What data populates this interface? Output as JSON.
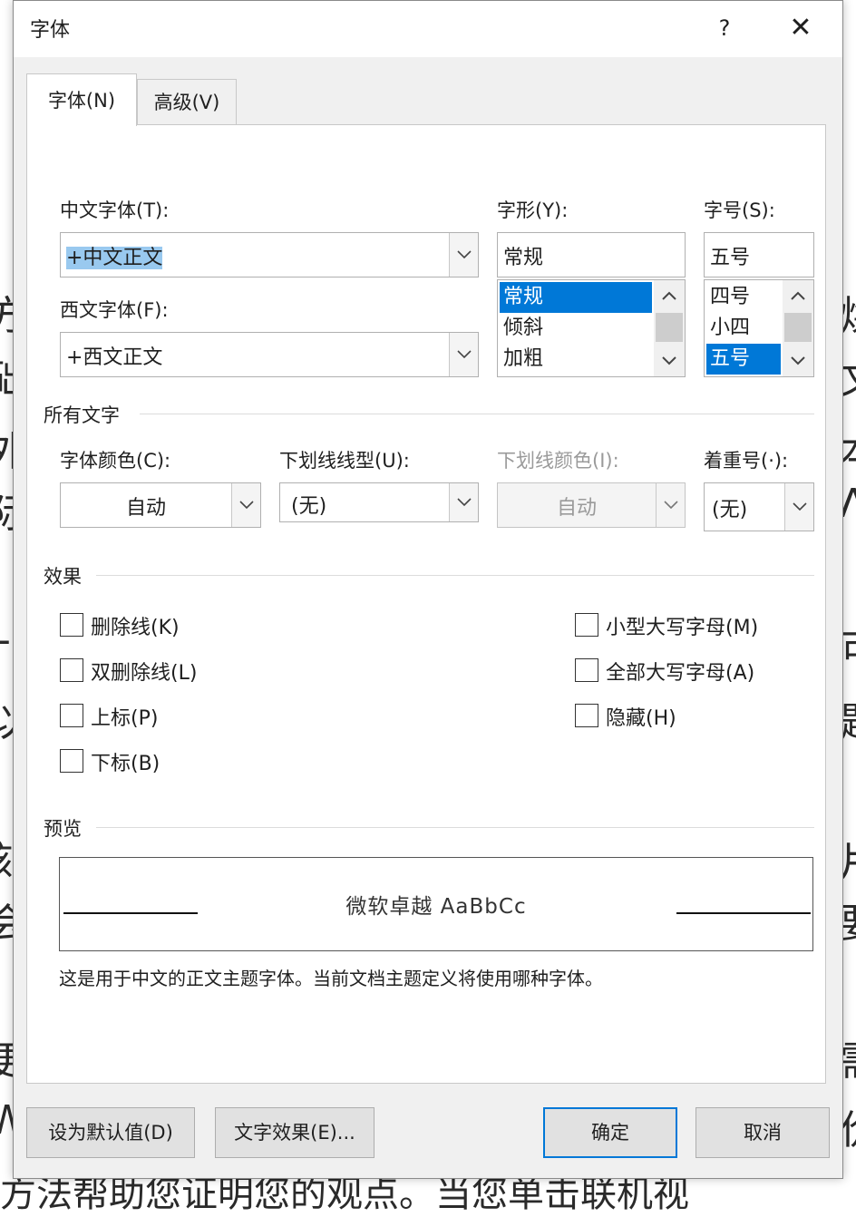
{
  "dialog": {
    "title": "字体",
    "help": "?",
    "close": "✕"
  },
  "tabs": [
    {
      "label": "字体(N)",
      "active": true
    },
    {
      "label": "高级(V)",
      "active": false
    }
  ],
  "fonts": {
    "chinese_label": "中文字体(T):",
    "chinese_value": "+中文正文",
    "western_label": "西文字体(F):",
    "western_value": "+西文正文"
  },
  "style": {
    "label": "字形(Y):",
    "value": "常规",
    "options": [
      "常规",
      "倾斜",
      "加粗"
    ],
    "selected": "常规"
  },
  "size": {
    "label": "字号(S):",
    "value": "五号",
    "options": [
      "四号",
      "小四",
      "五号"
    ],
    "selected": "五号"
  },
  "all_text": {
    "section": "所有文字",
    "font_color_label": "字体颜色(C):",
    "font_color_value": "自动",
    "underline_style_label": "下划线线型(U):",
    "underline_style_value": "(无)",
    "underline_color_label": "下划线颜色(I):",
    "underline_color_value": "自动",
    "emphasis_label": "着重号(·):",
    "emphasis_value": "(无)"
  },
  "effects": {
    "section": "效果",
    "left": [
      "删除线(K)",
      "双删除线(L)",
      "上标(P)",
      "下标(B)"
    ],
    "right": [
      "小型大写字母(M)",
      "全部大写字母(A)",
      "隐藏(H)"
    ]
  },
  "preview": {
    "section": "预览",
    "sample": "微软卓越  AaBbCc",
    "description": "这是用于中文的正文主题字体。当前文档主题定义将使用哪种字体。"
  },
  "buttons": {
    "set_default": "设为默认值(D)",
    "text_effects": "文字效果(E)...",
    "ok": "确定",
    "cancel": "取消"
  },
  "background_doc": {
    "left_chars": [
      "方",
      "础",
      "外",
      "际",
      "-",
      "以",
      "刻",
      "会",
      "更",
      "W"
    ],
    "right_chars": [
      "焕",
      "文",
      "本",
      "Λ",
      "可",
      "题",
      "片",
      "要",
      "需",
      "价"
    ],
    "bottom_line": "方法帮助您证明您的观点。当您单击联机视"
  },
  "colors": {
    "accent": "#0078d7",
    "dialog_bg": "#f0f0f0",
    "selection": "#99c9ef"
  }
}
